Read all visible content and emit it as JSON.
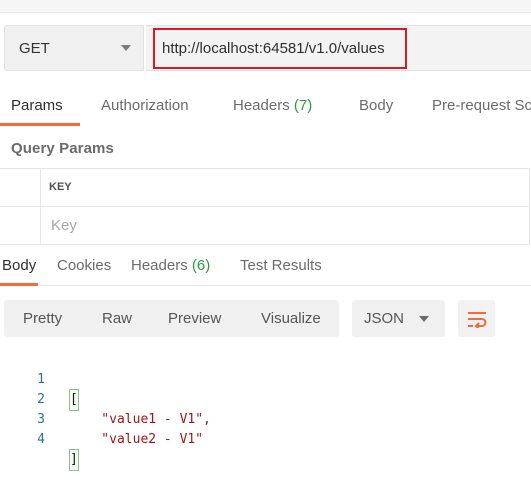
{
  "request": {
    "method": "GET",
    "url": "http://localhost:64581/v1.0/values"
  },
  "request_tabs": [
    {
      "label": "Params",
      "count": "",
      "active": true
    },
    {
      "label": "Authorization",
      "count": ""
    },
    {
      "label": "Headers",
      "count": "(7)"
    },
    {
      "label": "Body",
      "count": ""
    },
    {
      "label": "Pre-request Sc",
      "count": ""
    }
  ],
  "query_params": {
    "title": "Query Params",
    "key_header": "KEY",
    "key_placeholder": "Key"
  },
  "response_tabs": [
    {
      "label": "Body",
      "count": "",
      "active": true
    },
    {
      "label": "Cookies",
      "count": ""
    },
    {
      "label": "Headers",
      "count": "(6)"
    },
    {
      "label": "Test Results",
      "count": ""
    }
  ],
  "view": {
    "modes": [
      "Pretty",
      "Raw",
      "Preview",
      "Visualize"
    ],
    "format": "JSON",
    "wrap_icon": "wrap-lines-icon"
  },
  "code": {
    "line_numbers": [
      "1",
      "2",
      "3",
      "4"
    ],
    "lines": [
      "[",
      "    \"value1 - V1\",",
      "    \"value2 - V1\"",
      "]"
    ]
  },
  "colors": {
    "accent": "#f26b3a",
    "count": "#2b9a46",
    "url_highlight": "#d7192a"
  }
}
